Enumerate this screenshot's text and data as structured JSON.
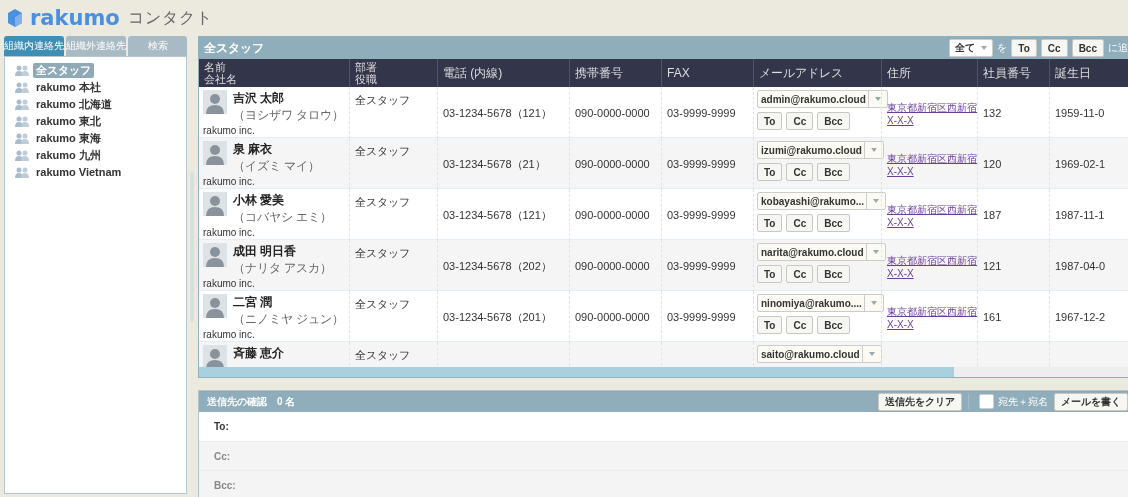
{
  "app": {
    "logo": "rakumo",
    "title": "コンタクト"
  },
  "sidebar": {
    "tabs": [
      {
        "label": "組織内連絡先",
        "selected": true
      },
      {
        "label": "組織外連絡先",
        "selected": false
      },
      {
        "label": "検索",
        "selected": false
      }
    ],
    "groups": [
      {
        "label": "全スタッフ",
        "selected": true
      },
      {
        "label": "rakumo 本社",
        "selected": false
      },
      {
        "label": "rakumo 北海道",
        "selected": false
      },
      {
        "label": "rakumo 東北",
        "selected": false
      },
      {
        "label": "rakumo 東海",
        "selected": false
      },
      {
        "label": "rakumo 九州",
        "selected": false
      },
      {
        "label": "rakumo Vietnam",
        "selected": false
      }
    ]
  },
  "list": {
    "title": "全スタッフ",
    "toolbar": {
      "select": "全て",
      "particle": "を",
      "buttons": [
        "To",
        "Cc",
        "Bcc"
      ],
      "suffix": "に追"
    },
    "columns": [
      {
        "label": "名前",
        "sublabel": "会社名"
      },
      {
        "label": "部署",
        "sublabel": "役職"
      },
      {
        "label": "電話 (内線)"
      },
      {
        "label": "携帯番号"
      },
      {
        "label": "FAX"
      },
      {
        "label": "メールアドレス"
      },
      {
        "label": "住所"
      },
      {
        "label": "社員番号"
      },
      {
        "label": "誕生日"
      }
    ],
    "rows": [
      {
        "name": "吉沢 太郎",
        "kana": "（ヨシザワ タロウ）",
        "company": "rakumo inc.",
        "department": "全スタッフ",
        "phone": "03-1234-5678（121）",
        "mobile": "090-0000-0000",
        "fax": "03-9999-9999",
        "email": "admin@rakumo.cloud",
        "buttons": [
          "To",
          "Cc",
          "Bcc"
        ],
        "address": "東京都新宿区西新宿",
        "address_line2": "X-X-X",
        "employee_no": "132",
        "birthday": "1959-11-0"
      },
      {
        "name": "泉 麻衣",
        "kana": "（イズミ マイ）",
        "company": "rakumo inc.",
        "department": "全スタッフ",
        "phone": "03-1234-5678（21）",
        "mobile": "090-0000-0000",
        "fax": "03-9999-9999",
        "email": "izumi@rakumo.cloud",
        "buttons": [
          "To",
          "Cc",
          "Bcc"
        ],
        "address": "東京都新宿区西新宿",
        "address_line2": "X-X-X",
        "employee_no": "120",
        "birthday": "1969-02-1"
      },
      {
        "name": "小林 愛美",
        "kana": "（コバヤシ エミ）",
        "company": "rakumo inc.",
        "department": "全スタッフ",
        "phone": "03-1234-5678（121）",
        "mobile": "090-0000-0000",
        "fax": "03-9999-9999",
        "email": "kobayashi@rakumo...",
        "buttons": [
          "To",
          "Cc",
          "Bcc"
        ],
        "address": "東京都新宿区西新宿",
        "address_line2": "X-X-X",
        "employee_no": "187",
        "birthday": "1987-11-1"
      },
      {
        "name": "成田 明日香",
        "kana": "（ナリタ アスカ）",
        "company": "rakumo inc.",
        "department": "全スタッフ",
        "phone": "03-1234-5678（202）",
        "mobile": "090-0000-0000",
        "fax": "03-9999-9999",
        "email": "narita@rakumo.cloud",
        "buttons": [
          "To",
          "Cc",
          "Bcc"
        ],
        "address": "東京都新宿区西新宿",
        "address_line2": "X-X-X",
        "employee_no": "121",
        "birthday": "1987-04-0"
      },
      {
        "name": "二宮 潤",
        "kana": "（ニノミヤ ジュン）",
        "company": "rakumo inc.",
        "department": "全スタッフ",
        "phone": "03-1234-5678（201）",
        "mobile": "090-0000-0000",
        "fax": "03-9999-9999",
        "email": "ninomiya@rakumo....",
        "buttons": [
          "To",
          "Cc",
          "Bcc"
        ],
        "address": "東京都新宿区西新宿",
        "address_line2": "X-X-X",
        "employee_no": "161",
        "birthday": "1967-12-2"
      },
      {
        "name": "斉藤 恵介",
        "department": "全スタッフ",
        "email": "saito@rakumo.cloud"
      }
    ]
  },
  "recipients": {
    "title": "送信先の確認",
    "count": "0 名",
    "clear_button": "送信先をクリア",
    "checkbox": {
      "label": "宛先＋宛名",
      "checked": false
    },
    "compose_button": "メールを書く",
    "fields": [
      "To:",
      "Cc:",
      "Bcc:"
    ]
  }
}
